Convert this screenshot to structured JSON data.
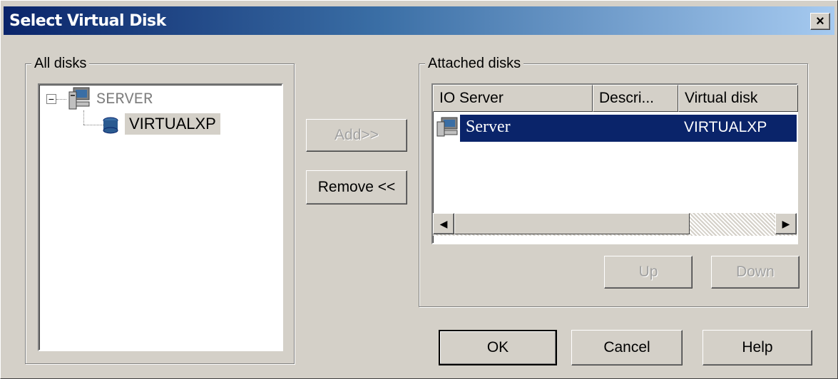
{
  "window": {
    "title": "Select Virtual Disk",
    "close_glyph": "×"
  },
  "all_disks": {
    "label": "All disks",
    "tree": {
      "expander": "−",
      "server": {
        "label": "SERVER",
        "icon": "computer-icon"
      },
      "disk": {
        "label": "VIRTUALXP",
        "icon": "disk-icon"
      }
    }
  },
  "buttons": {
    "add": "Add>>",
    "remove": "Remove <<",
    "up": "Up",
    "down": "Down",
    "ok": "OK",
    "cancel": "Cancel",
    "help": "Help"
  },
  "attached_disks": {
    "label": "Attached disks",
    "columns": [
      "IO Server",
      "Descri...",
      "Virtual disk"
    ],
    "rows": [
      {
        "io_server": "Server",
        "description": "",
        "virtual_disk": "VIRTUALXP",
        "icon": "computer-icon",
        "selected": true
      }
    ],
    "scroll_left": "◀",
    "scroll_right": "▶"
  },
  "colors": {
    "selection": "#0a246a",
    "face": "#d4d0c8"
  }
}
